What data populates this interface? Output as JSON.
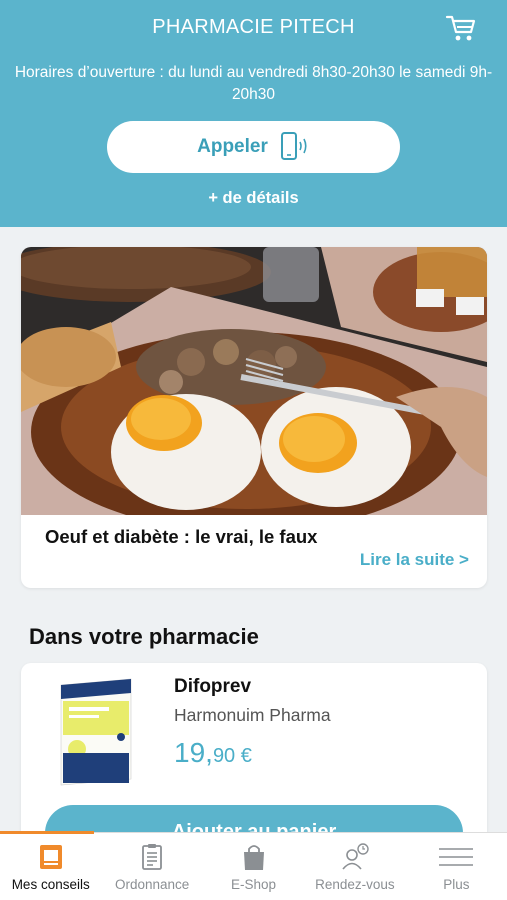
{
  "header": {
    "pharmacy_name": "PHARMACIE PITECH",
    "hours": "Horaires d’ouverture : du lundi au vendredi 8h30-20h30 le samedi 9h-20h30",
    "call_label": "Appeler",
    "details_label": "+ de détails",
    "cart_icon": "cart-icon"
  },
  "article": {
    "title": "Oeuf et diabète : le vrai, le faux",
    "read_more": "Lire la suite >"
  },
  "pharmacy_section": {
    "title": "Dans votre pharmacie"
  },
  "product": {
    "name": "Difoprev",
    "brand": "Harmonuim Pharma",
    "price_int": "19,",
    "price_dec": "90 €",
    "add_to_cart": "Ajouter au panier"
  },
  "tabbar": {
    "tabs": [
      {
        "label": "Mes conseils",
        "icon": "tips-icon",
        "active": true
      },
      {
        "label": "Ordonnance",
        "icon": "prescription-icon",
        "active": false
      },
      {
        "label": "E-Shop",
        "icon": "shopping-bag-icon",
        "active": false
      },
      {
        "label": "Rendez-vous",
        "icon": "appointment-icon",
        "active": false
      },
      {
        "label": "Plus",
        "icon": "menu-icon",
        "active": false
      }
    ]
  },
  "colors": {
    "primary": "#5bb4cc",
    "accent_text": "#4aaec8",
    "active_tab": "#f08a2b"
  }
}
